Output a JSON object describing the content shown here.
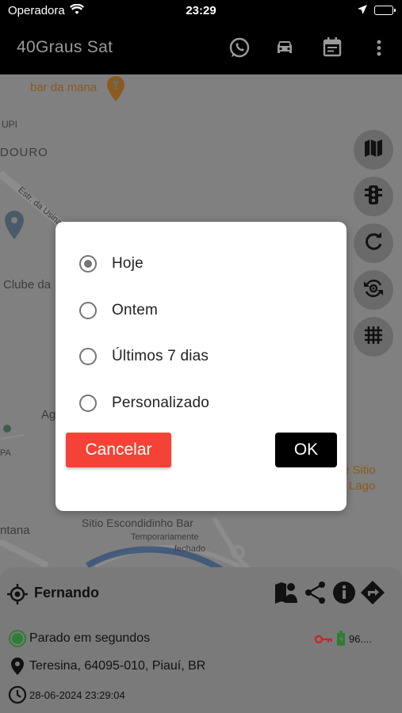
{
  "status_bar": {
    "carrier": "Operadora",
    "time": "23:29"
  },
  "app_bar": {
    "title": "40Graus Sat",
    "icons": [
      "whatsapp-icon",
      "car-icon",
      "calendar-icon",
      "more-vert-icon"
    ]
  },
  "map": {
    "labels": {
      "bar_mana": "bar da mana",
      "upi": "UPI",
      "douro": "DOURO",
      "estr": "Estr. da Usina",
      "clube": "Clube da",
      "ag": "Ag",
      "pa": "PA",
      "sitio": "e Sitio",
      "lago": "Lago",
      "ntana": "ntana",
      "escondidinho": "Sitio Escondidinho Bar",
      "temp1": "Temporariamente",
      "temp2": "fechado"
    },
    "fabs": [
      "map-icon",
      "traffic-light-icon",
      "refresh-icon",
      "sync-location-icon",
      "grid-icon"
    ]
  },
  "dialog": {
    "options": [
      {
        "label": "Hoje",
        "selected": true
      },
      {
        "label": "Ontem",
        "selected": false
      },
      {
        "label": "Últimos 7 dias",
        "selected": false
      },
      {
        "label": "Personalizado",
        "selected": false
      }
    ],
    "cancel_label": "Cancelar",
    "ok_label": "OK"
  },
  "panel": {
    "vehicle_name": "Fernando",
    "status": "Parado em segundos",
    "address": "Teresina, 64095-010, Piauí, BR",
    "timestamp": "28-06-2024 23:29:04",
    "battery_text": "96....",
    "actions": [
      "map-person-icon",
      "share-icon",
      "info-icon",
      "directions-icon"
    ]
  },
  "colors": {
    "accent_red": "#f44336",
    "ok_black": "#000000",
    "status_green": "#2e7d32",
    "key_red": "#c62828"
  }
}
